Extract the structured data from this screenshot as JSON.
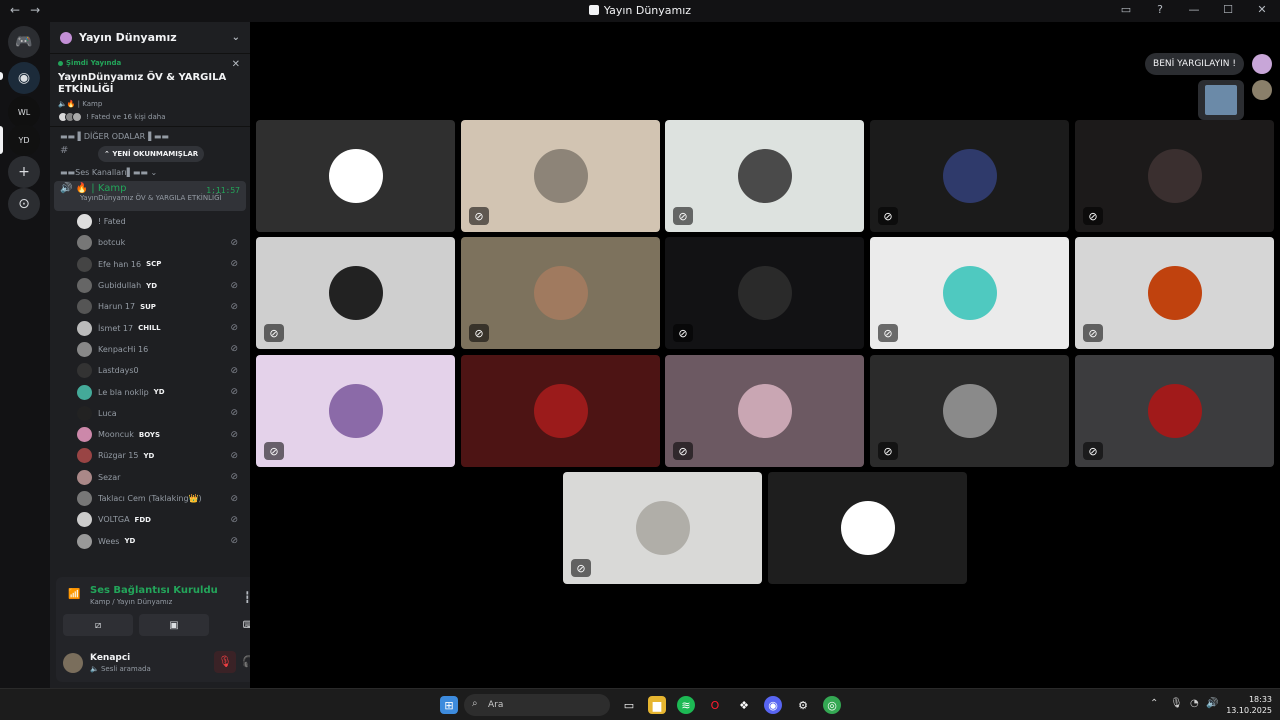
{
  "window": {
    "title": "Yayın Dünyamız",
    "nav_back": "←",
    "nav_forward": "→",
    "controls": [
      "▭",
      "?",
      "—",
      "☐",
      "✕"
    ]
  },
  "rail": {
    "icons": [
      "discord-home-icon",
      "server-icon",
      "server-icon",
      "server-icon",
      "add-server-icon",
      "discover-icon"
    ],
    "glyphs": [
      "🎮",
      "◉",
      "WL",
      "YD",
      "+",
      "⊙"
    ]
  },
  "sidebar": {
    "server_name": "Yayın Dünyamız",
    "event": {
      "live_label": "Şimdi Yayında",
      "title": "YayınDünyamız ÖV & YARGILA ETKİNLİĞİ",
      "location": "Kamp",
      "people": "! Fated ve 16 kişi daha"
    },
    "category_other": "DİĞER ODALAR",
    "unread_label": "YENİ OKUNMAMIŞLAR",
    "category_voice": "Ses Kanalları",
    "voice_channel": {
      "name": "Kamp",
      "time": "1:11:57",
      "subtitle": "YayınDünyamız ÖV & YARGILA ETKİNLİĞİ"
    },
    "members": [
      {
        "name": "! Fated",
        "tag": "",
        "muted": false
      },
      {
        "name": "botcuk",
        "tag": "",
        "muted": true
      },
      {
        "name": "Efe han 16",
        "tag": "SCP",
        "muted": true
      },
      {
        "name": "Gubidullah",
        "tag": "YD",
        "muted": true
      },
      {
        "name": "Harun 17",
        "tag": "SUP",
        "muted": true
      },
      {
        "name": "İsmet 17",
        "tag": "CHILL",
        "muted": true
      },
      {
        "name": "KenpacHi 16",
        "tag": "",
        "muted": true
      },
      {
        "name": "Lastdays0",
        "tag": "",
        "muted": true
      },
      {
        "name": "Le bla noklip",
        "tag": "YD",
        "muted": true
      },
      {
        "name": "Luca",
        "tag": "",
        "muted": true
      },
      {
        "name": "Mooncuk",
        "tag": "BOYS",
        "muted": true
      },
      {
        "name": "Rüzgar 15",
        "tag": "YD",
        "muted": true
      },
      {
        "name": "Sezar",
        "tag": "",
        "muted": true
      },
      {
        "name": "Taklacı Cem (Taklaking👑)",
        "tag": "",
        "muted": true
      },
      {
        "name": "VOLTGA",
        "tag": "FDD",
        "muted": true
      },
      {
        "name": "Wees",
        "tag": "YD",
        "muted": true
      }
    ],
    "voice_panel": {
      "status": "Ses Bağlantısı Kuruldu",
      "location": "Kamp / Yayın Dünyamız"
    },
    "user": {
      "name": "Kenapci",
      "status": "Sesli aramada"
    }
  },
  "stage": {
    "pill_label": "BENİ YARGILAYIN !",
    "tiles": [
      {
        "bg": "#2f2f2f",
        "av": "#ffffff",
        "glyph": "🐱",
        "muted": false
      },
      {
        "bg": "#d2c4b2",
        "av": "#8d8478",
        "glyph": "",
        "muted": true
      },
      {
        "bg": "#dde2df",
        "av": "#4a4a4a",
        "glyph": "",
        "muted": true
      },
      {
        "bg": "#1b1b1b",
        "av": "#2f3a6b",
        "glyph": "",
        "muted": true
      },
      {
        "bg": "#1c1a1a",
        "av": "#3a2f2f",
        "glyph": "",
        "muted": true
      },
      {
        "bg": "#cfcfcf",
        "av": "#222222",
        "glyph": "",
        "muted": true
      },
      {
        "bg": "#7d725d",
        "av": "#a07a5f",
        "glyph": "",
        "muted": true
      },
      {
        "bg": "#121214",
        "av": "#2a2a2a",
        "glyph": "",
        "muted": true
      },
      {
        "bg": "#ebebeb",
        "av": "#4fc9c0",
        "glyph": "",
        "muted": true
      },
      {
        "bg": "#d6d6d6",
        "av": "#c0420e",
        "glyph": "",
        "muted": true
      },
      {
        "bg": "#e4d2ea",
        "av": "#8b6aa8",
        "glyph": "",
        "muted": true
      },
      {
        "bg": "#4d1414",
        "av": "#9b1b1b",
        "glyph": "",
        "muted": false
      },
      {
        "bg": "#6c5962",
        "av": "#c9a6b3",
        "glyph": "",
        "muted": true
      },
      {
        "bg": "#2b2b2b",
        "av": "#8a8a8a",
        "glyph": "",
        "muted": true
      },
      {
        "bg": "#3c3c3e",
        "av": "#a11a1a",
        "glyph": "",
        "muted": true
      },
      {
        "bg": "#d9d9d7",
        "av": "#b0aea8",
        "glyph": "",
        "muted": true
      },
      {
        "bg": "#1e1e1e",
        "av": "#ffffff",
        "glyph": "",
        "muted": false
      }
    ]
  },
  "taskbar": {
    "search_placeholder": "Ara",
    "time": "18:33",
    "date": "13.10.2025"
  }
}
